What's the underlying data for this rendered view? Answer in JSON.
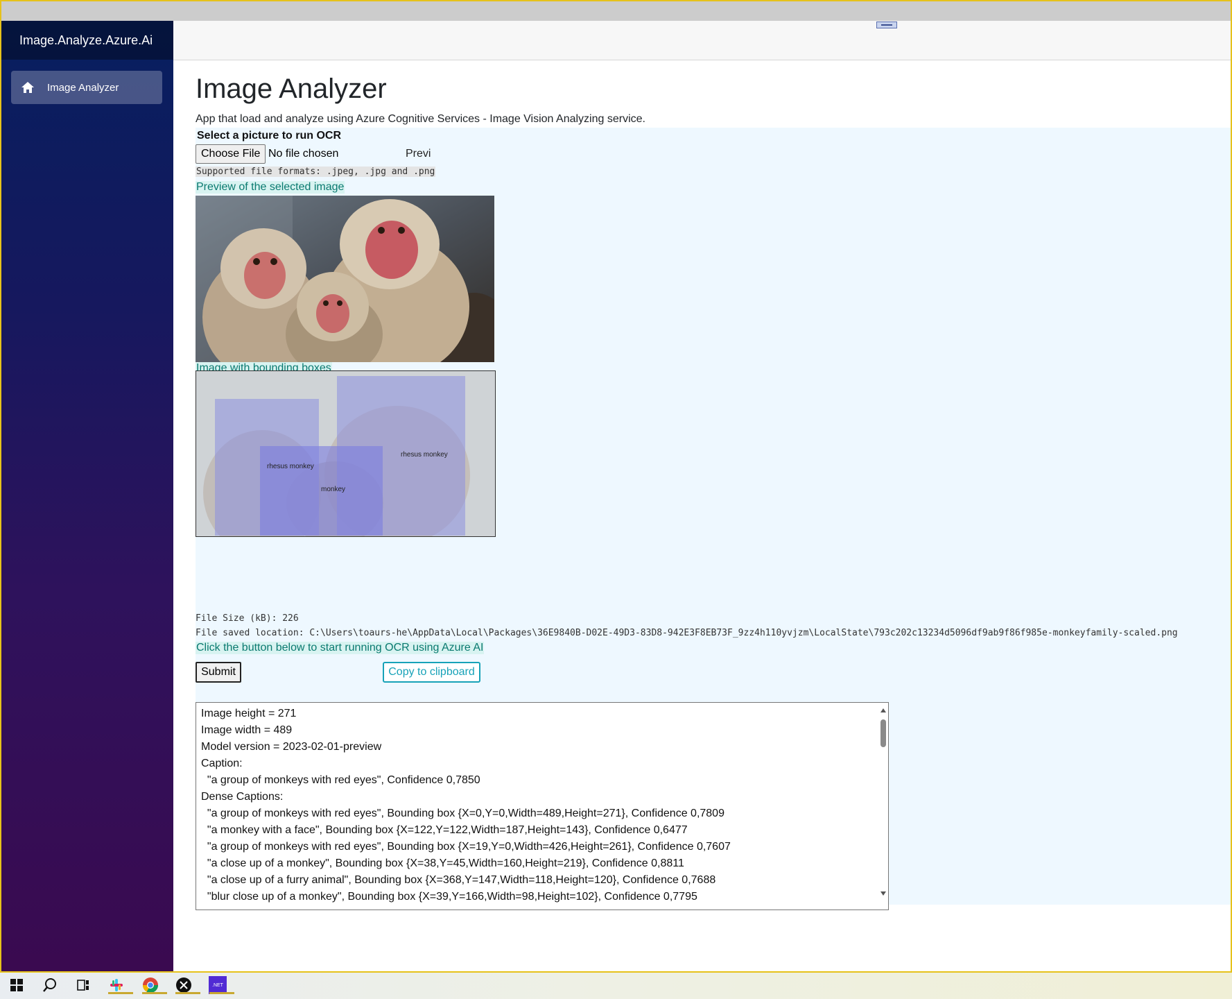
{
  "app": {
    "brand": "Image.Analyze.Azure.Ai"
  },
  "nav": {
    "items": [
      {
        "label": "Image Analyzer",
        "icon": "home-icon"
      }
    ]
  },
  "page": {
    "title": "Image Analyzer",
    "subtitle": "App that load and analyze using Azure Cognitive Services - Image Vision Analyzing service."
  },
  "upload": {
    "label": "Select a picture to run OCR",
    "choose_button": "Choose File",
    "status": "No file chosen",
    "preview_tab": "Previ",
    "formats": "Supported file formats: .jpeg, .jpg and .png"
  },
  "preview": {
    "caption": "Preview of the selected image"
  },
  "bounding": {
    "caption": "Image with bounding boxes",
    "labels": [
      "rhesus monkey",
      "rhesus monkey",
      "monkey"
    ]
  },
  "file": {
    "size_line": "File Size (kB): 226",
    "location_line": "File saved location: C:\\Users\\toaurs-he\\AppData\\Local\\Packages\\36E9840B-D02E-49D3-83D8-942E3F8EB73F_9zz4h110yvjzm\\LocalState\\793c202c13234d5096df9ab9f86f985e-monkeyfamily-scaled.png"
  },
  "actions": {
    "hint": "Click the button below to start running OCR using Azure AI",
    "submit": "Submit",
    "copy": "Copy to clipboard"
  },
  "result": {
    "text": "Image height = 271\nImage width = 489\nModel version = 2023-02-01-preview\nCaption:\n  \"a group of monkeys with red eyes\", Confidence 0,7850\nDense Captions:\n  \"a group of monkeys with red eyes\", Bounding box {X=0,Y=0,Width=489,Height=271}, Confidence 0,7809\n  \"a monkey with a face\", Bounding box {X=122,Y=122,Width=187,Height=143}, Confidence 0,6477\n  \"a group of monkeys with red eyes\", Bounding box {X=19,Y=0,Width=426,Height=261}, Confidence 0,7607\n  \"a close up of a monkey\", Bounding box {X=38,Y=45,Width=160,Height=219}, Confidence 0,8811\n  \"a close up of a furry animal\", Bounding box {X=368,Y=147,Width=118,Height=120}, Confidence 0,7688\n  \"blur close up of a monkey\", Bounding box {X=39,Y=166,Width=98,Height=102}, Confidence 0,7795"
  },
  "taskbar": {
    "items": [
      "windows-start-icon",
      "search-icon",
      "task-view-icon",
      "slack-icon",
      "chrome-icon",
      "x-app-icon",
      "dotnet-icon"
    ],
    "dotnet_label": ".NET"
  },
  "colors": {
    "sidebar_top": "#071f5f",
    "sidebar_bottom": "#3a0a50",
    "panel_bg": "#eef8ff",
    "accent_teal": "#17a2b8",
    "caption_teal": "#0a7a70"
  }
}
